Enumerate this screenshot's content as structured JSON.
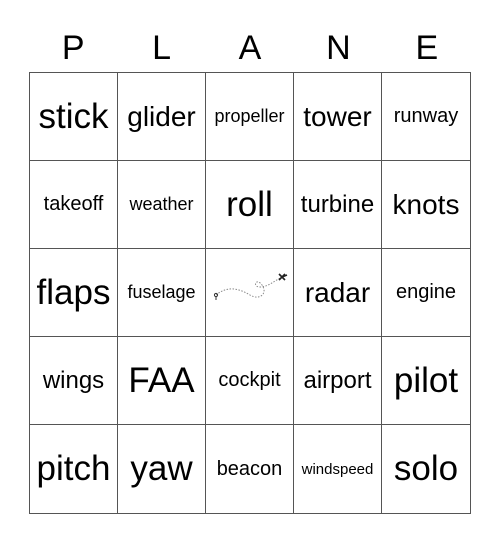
{
  "header": [
    "P",
    "L",
    "A",
    "N",
    "E"
  ],
  "cells": [
    {
      "text": "stick",
      "size": "s1"
    },
    {
      "text": "glider",
      "size": "s2"
    },
    {
      "text": "propeller",
      "size": "s5"
    },
    {
      "text": "tower",
      "size": "s2"
    },
    {
      "text": "runway",
      "size": "s4"
    },
    {
      "text": "takeoff",
      "size": "s4"
    },
    {
      "text": "weather",
      "size": "s5"
    },
    {
      "text": "roll",
      "size": "s1"
    },
    {
      "text": "turbine",
      "size": "s3"
    },
    {
      "text": "knots",
      "size": "s2"
    },
    {
      "text": "flaps",
      "size": "s1"
    },
    {
      "text": "fuselage",
      "size": "s5"
    },
    {
      "text": "",
      "size": "free",
      "icon": "plane-flight-path-icon"
    },
    {
      "text": "radar",
      "size": "s2"
    },
    {
      "text": "engine",
      "size": "s4"
    },
    {
      "text": "wings",
      "size": "s3"
    },
    {
      "text": "FAA",
      "size": "s1"
    },
    {
      "text": "cockpit",
      "size": "s4"
    },
    {
      "text": "airport",
      "size": "s3"
    },
    {
      "text": "pilot",
      "size": "s1"
    },
    {
      "text": "pitch",
      "size": "s1"
    },
    {
      "text": "yaw",
      "size": "s1"
    },
    {
      "text": "beacon",
      "size": "s4"
    },
    {
      "text": "windspeed",
      "size": "s6"
    },
    {
      "text": "solo",
      "size": "s1"
    }
  ]
}
